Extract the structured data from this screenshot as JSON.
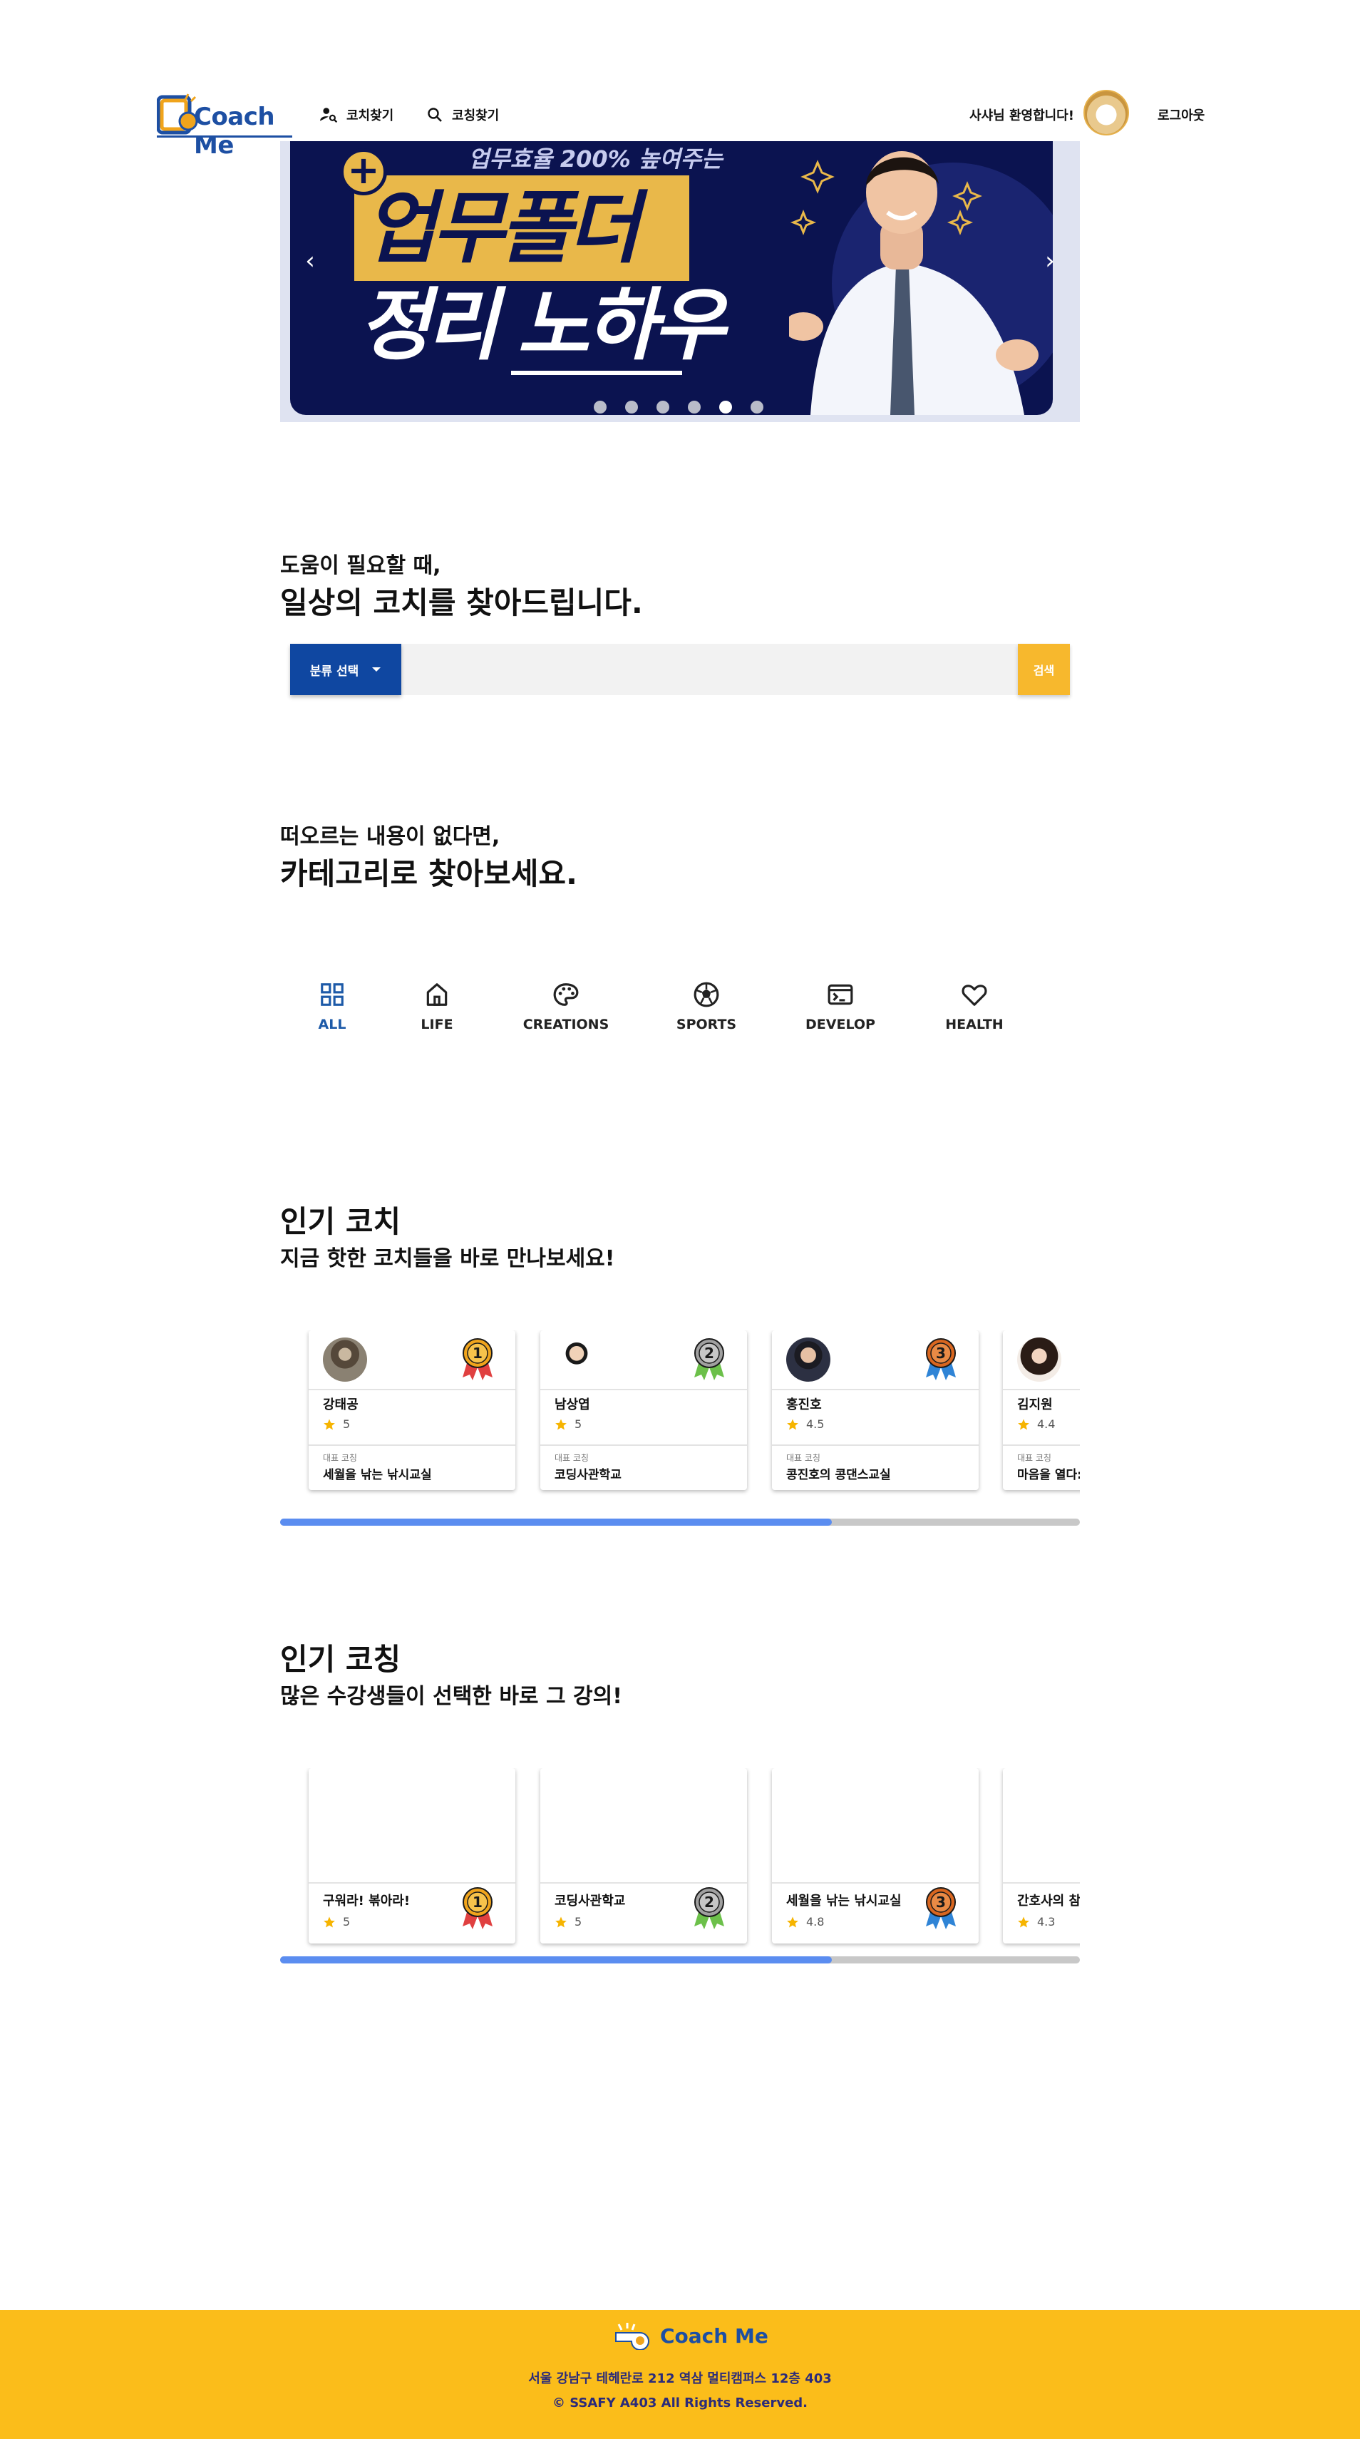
{
  "header": {
    "logo_text": "Coach Me",
    "nav": [
      {
        "label": "코치찾기",
        "icon": "person-search-icon"
      },
      {
        "label": "코칭찾기",
        "icon": "search-icon"
      }
    ],
    "welcome": "사샤님 환영합니다!",
    "logout": "로그아웃"
  },
  "banner": {
    "subtitle": "업무효율 200% 높여주는",
    "line1": "업무폴더",
    "line2": "정리 노하우",
    "slide_count": 6,
    "active_slide": 5
  },
  "search": {
    "title_small": "도움이 필요할 때,",
    "title_big": "일상의 코치를 찾아드립니다.",
    "category_button": "분류 선택",
    "input_value": "",
    "search_button": "검색"
  },
  "categories": {
    "title_small": "떠오르는 내용이 없다면,",
    "title_big": "카테고리로 찾아보세요.",
    "items": [
      {
        "label": "ALL",
        "icon": "grid-icon",
        "active": true
      },
      {
        "label": "LIFE",
        "icon": "home-icon",
        "active": false
      },
      {
        "label": "CREATIONS",
        "icon": "palette-icon",
        "active": false
      },
      {
        "label": "SPORTS",
        "icon": "soccer-ball-icon",
        "active": false
      },
      {
        "label": "DEVELOP",
        "icon": "terminal-icon",
        "active": false
      },
      {
        "label": "HEALTH",
        "icon": "heart-icon",
        "active": false
      }
    ]
  },
  "popular_coaches": {
    "title": "인기 코치",
    "subtitle": "지금 핫한 코치들을 바로 만나보세요!",
    "rep_label": "대표 코칭",
    "cards": [
      {
        "name": "강태공",
        "rating": "5",
        "rep": "세월을 낚는 낚시교실",
        "rank": "1",
        "medal_color": "#f0a41c"
      },
      {
        "name": "남상엽",
        "rating": "5",
        "rep": "코딩사관학교",
        "rank": "2",
        "medal_color": "#a0a0a0"
      },
      {
        "name": "홍진호",
        "rating": "4.5",
        "rep": "콩진호의 콩댄스교실",
        "rank": "3",
        "medal_color": "#d9661f"
      },
      {
        "name": "김지원",
        "rating": "4.4",
        "rep": "마음을 열다:",
        "rank": "",
        "medal_color": ""
      }
    ],
    "scroll_fraction": 0.69
  },
  "popular_coachings": {
    "title": "인기 코칭",
    "subtitle": "많은 수강생들이 선택한 바로 그 강의!",
    "cards": [
      {
        "title": "구워라! 볶아라!",
        "rating": "5",
        "rank": "1",
        "medal_color": "#f0a41c"
      },
      {
        "title": "코딩사관학교",
        "rating": "5",
        "rank": "2",
        "medal_color": "#a0a0a0"
      },
      {
        "title": "세월을 낚는 낚시교실",
        "rating": "4.8",
        "rank": "3",
        "medal_color": "#d9661f"
      },
      {
        "title": "간호사의 참:",
        "rating": "4.3",
        "rank": "",
        "medal_color": ""
      }
    ],
    "scroll_fraction": 0.69
  },
  "footer": {
    "logo_text": "Coach Me",
    "address": "서울 강남구 테헤란로 212 역삼 멀티캠퍼스 12층 403",
    "copyright": "© SSAFY A403 All Rights Reserved."
  },
  "colors": {
    "brand_blue": "#1d4fa3",
    "primary": "#0f47a1",
    "accent_yellow": "#fbbd1a",
    "scroll_thumb": "#5b8df0",
    "star": "#f6b400"
  }
}
